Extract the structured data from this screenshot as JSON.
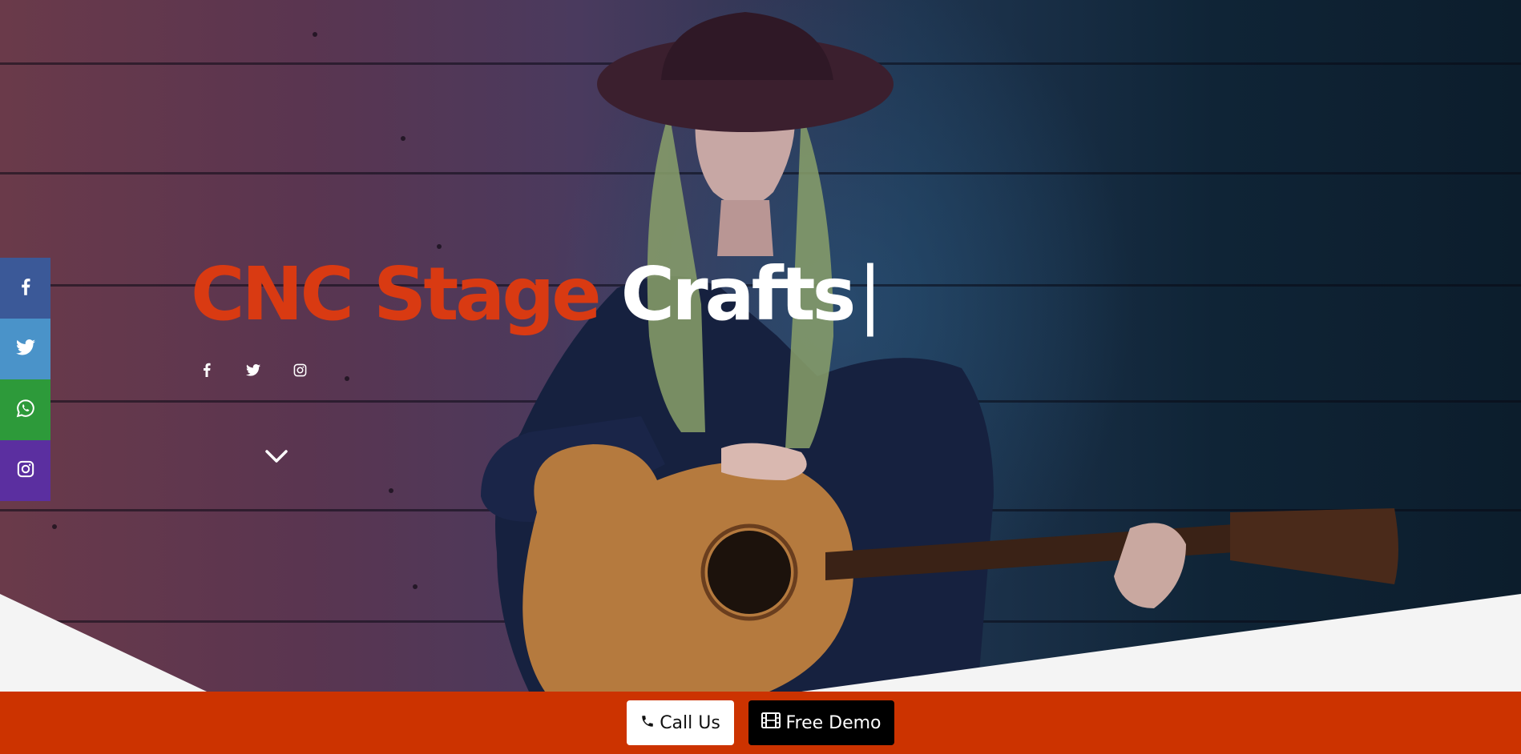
{
  "hero": {
    "title_part1": "CNC Stage",
    "title_part2": "Crafts",
    "cursor": "|"
  },
  "hero_social": [
    {
      "icon": "facebook-icon"
    },
    {
      "icon": "twitter-icon"
    },
    {
      "icon": "instagram-icon"
    }
  ],
  "side_share": [
    {
      "icon": "facebook-icon",
      "color": "#3b5998"
    },
    {
      "icon": "twitter-icon",
      "color": "#4a93c9"
    },
    {
      "icon": "whatsapp-icon",
      "color": "#2d9a3a"
    },
    {
      "icon": "instagram-icon",
      "color": "#5b2fa0"
    }
  ],
  "bottom_bar": {
    "background": "#cc3300",
    "call_label": "Call Us",
    "demo_label": "Free Demo"
  }
}
